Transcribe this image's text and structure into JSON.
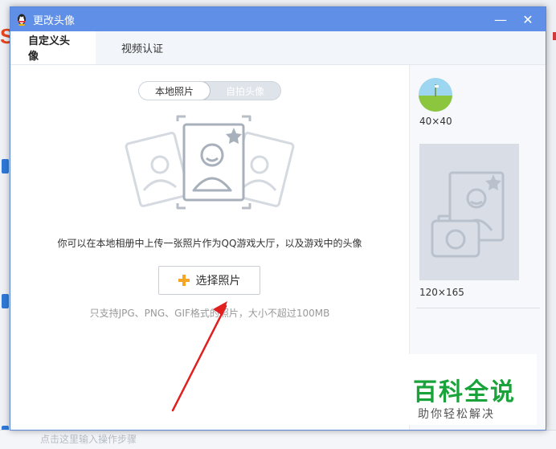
{
  "window": {
    "title": "更改头像",
    "minimize_glyph": "—",
    "close_glyph": "✕"
  },
  "tabs": [
    {
      "label": "自定义头像",
      "active": true
    },
    {
      "label": "视频认证",
      "active": false
    }
  ],
  "source_toggle": {
    "options": [
      "本地照片",
      "自拍头像"
    ],
    "selected": "本地照片"
  },
  "main": {
    "description": "你可以在本地相册中上传一张照片作为QQ游戏大厅，以及游戏中的头像",
    "choose_button_label": "选择照片",
    "hint": "只支持JPG、PNG、GIF格式的照片，大小不超过100MB",
    "illustration_icon": "photo-portrait-icon"
  },
  "preview": {
    "small_size_label": "40×40",
    "large_size_label": "120×165"
  },
  "background": {
    "bottom_hint": "点击这里输入操作步骤"
  },
  "watermark": {
    "title": "百科全说",
    "subtitle": "助你轻松解决"
  },
  "colors": {
    "titlebar": "#5f8fe6",
    "accent_plus": "#f5a623",
    "arrow": "#e02020",
    "watermark_green": "#1aa33a"
  }
}
